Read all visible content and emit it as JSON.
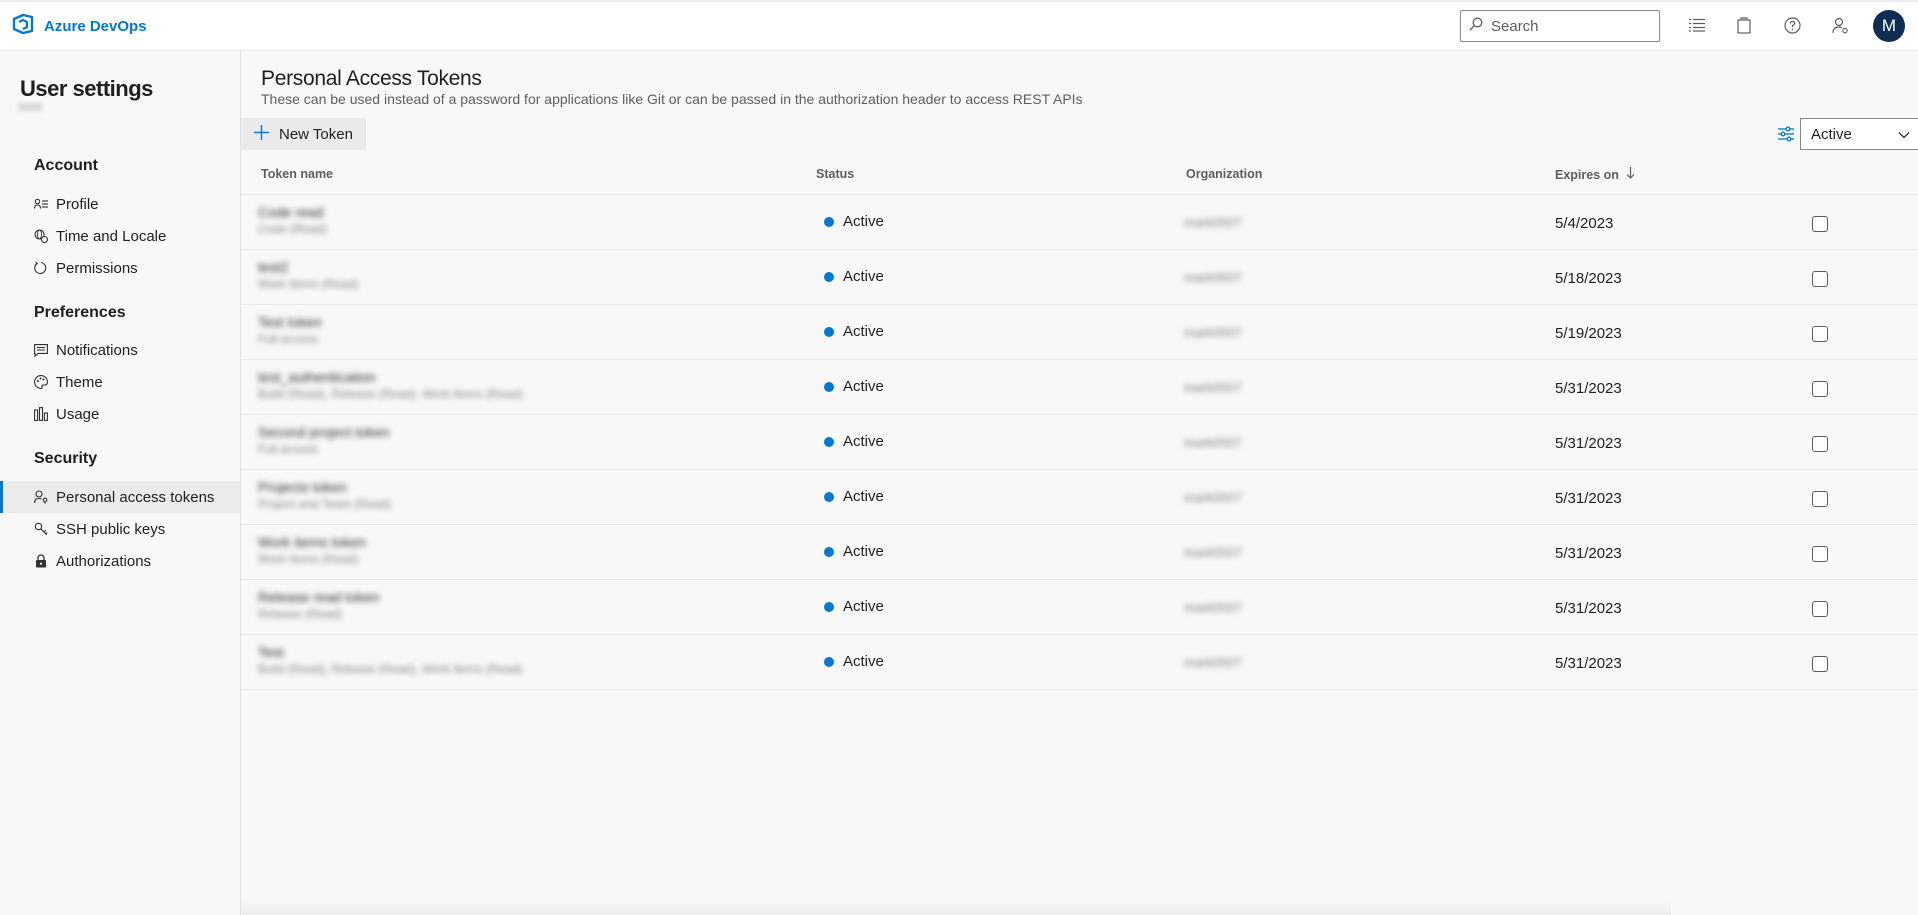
{
  "header": {
    "brand": "Azure DevOps",
    "search_placeholder": "Search",
    "avatar_initial": "M",
    "icons": [
      "list-icon",
      "shopping-bag-icon",
      "help-icon",
      "user-settings-icon"
    ]
  },
  "sidebar": {
    "title": "User settings",
    "sections": [
      {
        "heading": "Account",
        "items": [
          {
            "label": "Profile",
            "icon": "profile-icon"
          },
          {
            "label": "Time and Locale",
            "icon": "globe-icon"
          },
          {
            "label": "Permissions",
            "icon": "permissions-icon"
          }
        ]
      },
      {
        "heading": "Preferences",
        "items": [
          {
            "label": "Notifications",
            "icon": "notification-icon"
          },
          {
            "label": "Theme",
            "icon": "palette-icon"
          },
          {
            "label": "Usage",
            "icon": "usage-icon"
          }
        ]
      },
      {
        "heading": "Security",
        "items": [
          {
            "label": "Personal access tokens",
            "icon": "token-icon",
            "selected": true
          },
          {
            "label": "SSH public keys",
            "icon": "key-icon"
          },
          {
            "label": "Authorizations",
            "icon": "lock-icon"
          }
        ]
      }
    ]
  },
  "main": {
    "title": "Personal Access Tokens",
    "description": "These can be used instead of a password for applications like Git or can be passed in the authorization header to access REST APIs",
    "new_token_label": "New Token",
    "filter_value": "Active",
    "columns": {
      "name": "Token name",
      "status": "Status",
      "org": "Organization",
      "expires": "Expires on"
    },
    "rows": [
      {
        "name": "Code read",
        "scope": "Code (Read)",
        "status": "Active",
        "org": "mark0507",
        "expires": "5/4/2023"
      },
      {
        "name": "test2",
        "scope": "Work Items (Read)",
        "status": "Active",
        "org": "mark0507",
        "expires": "5/18/2023"
      },
      {
        "name": "Test token",
        "scope": "Full access",
        "status": "Active",
        "org": "mark0507",
        "expires": "5/19/2023"
      },
      {
        "name": "test_authentication",
        "scope": "Build (Read), Release (Read), Work Items (Read)",
        "status": "Active",
        "org": "mark0507",
        "expires": "5/31/2023"
      },
      {
        "name": "Second project token",
        "scope": "Full access",
        "status": "Active",
        "org": "mark0507",
        "expires": "5/31/2023"
      },
      {
        "name": "Projects token",
        "scope": "Project and Team (Read)",
        "status": "Active",
        "org": "mark0507",
        "expires": "5/31/2023"
      },
      {
        "name": "Work items token",
        "scope": "Work Items (Read)",
        "status": "Active",
        "org": "mark0507",
        "expires": "5/31/2023"
      },
      {
        "name": "Release read token",
        "scope": "Release (Read)",
        "status": "Active",
        "org": "mark0507",
        "expires": "5/31/2023"
      },
      {
        "name": "Test",
        "scope": "Build (Read), Release (Read), Work Items (Read)",
        "status": "Active",
        "org": "mark0507",
        "expires": "5/31/2023"
      }
    ]
  },
  "colors": {
    "accent": "#0078d4",
    "avatar_bg": "#0f2d52"
  }
}
